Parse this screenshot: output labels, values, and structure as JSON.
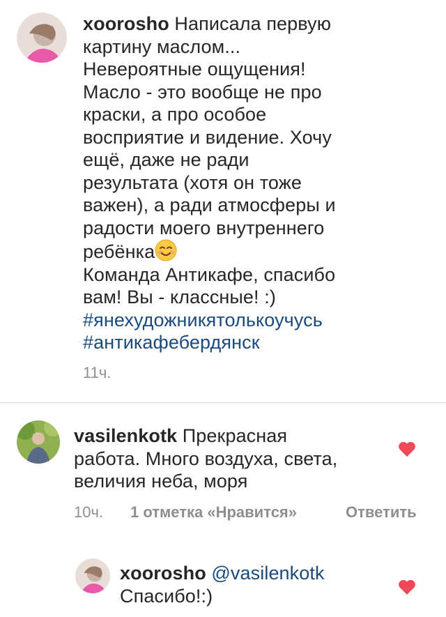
{
  "caption": {
    "username": "xoorosho",
    "text_lines": [
      "Написала первую",
      "картину маслом...",
      "Невероятные ощущения!",
      "Масло - это вообще не про",
      "краски, а про особое",
      "восприятие и видение. Хочу",
      "ещё, даже не ради",
      "результата (хотя он тоже",
      "важен), а ради атмосферы и",
      "радости моего внутреннего",
      "ребёнка",
      "Команда Антикафе, спасибо",
      "вам! Вы - классные! :)"
    ],
    "emoji": "smiling-face-emoji",
    "hashtags": [
      "#янехудожникятолькоучусь",
      "#антикафебердянск"
    ],
    "time": "11ч."
  },
  "comment": {
    "username": "vasilenkotk",
    "text_lines": [
      "Прекрасная",
      "работа. Много воздуха, света,",
      "величия неба, моря"
    ],
    "time": "10ч.",
    "likes": "1 отметка «Нравится»",
    "reply_label": "Ответить",
    "like_icon": "heart-icon",
    "like_color": "#ed4956"
  },
  "reply": {
    "username": "xoorosho",
    "mention": "@vasilenkotk",
    "text": "Спасибо!:)",
    "like_icon": "heart-icon"
  }
}
